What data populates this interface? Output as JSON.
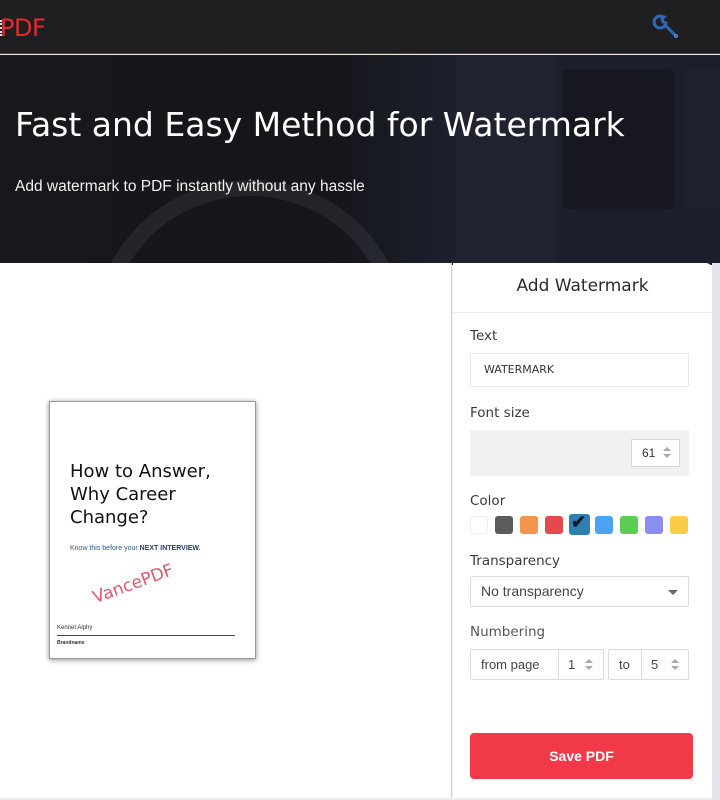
{
  "header": {
    "logo_text": "PDF",
    "tools_icon": "wrench-icon"
  },
  "hero": {
    "title": "Fast and Easy Method for Watermark",
    "subtitle": "Add watermark to PDF instantly without any hassle"
  },
  "preview": {
    "title_lines": [
      "How to Answer,",
      "Why Career",
      "Change?"
    ],
    "subtitle_prefix": "Know this before your ",
    "subtitle_bold": "NEXT INTERVIEW.",
    "watermark_text": "VancePDF",
    "author": "Kennet Alphy",
    "brand": "Brandname"
  },
  "panel": {
    "heading": "Add Watermark",
    "text_label": "Text",
    "text_value": "WATERMARK",
    "font_size_label": "Font size",
    "font_size_value": "61",
    "color_label": "Color",
    "colors": [
      {
        "name": "white",
        "hex": "#ffffff",
        "selected": false
      },
      {
        "name": "dark-gray",
        "hex": "#5b5b5b",
        "selected": false
      },
      {
        "name": "orange",
        "hex": "#f5924b",
        "selected": false
      },
      {
        "name": "red",
        "hex": "#e5484d",
        "selected": false
      },
      {
        "name": "steel-blue",
        "hex": "#2f7fb0",
        "selected": true
      },
      {
        "name": "light-blue",
        "hex": "#4aa3f5",
        "selected": false
      },
      {
        "name": "green",
        "hex": "#5dcc52",
        "selected": false
      },
      {
        "name": "lavender",
        "hex": "#8a8ef0",
        "selected": false
      },
      {
        "name": "yellow",
        "hex": "#fbcc45",
        "selected": false
      }
    ],
    "transparency_label": "Transparency",
    "transparency_value": "No transparency",
    "numbering_label": "Numbering",
    "from_page_label": "from page",
    "from_page_value": "1",
    "to_label": "to",
    "to_value": "5",
    "save_label": "Save PDF"
  }
}
